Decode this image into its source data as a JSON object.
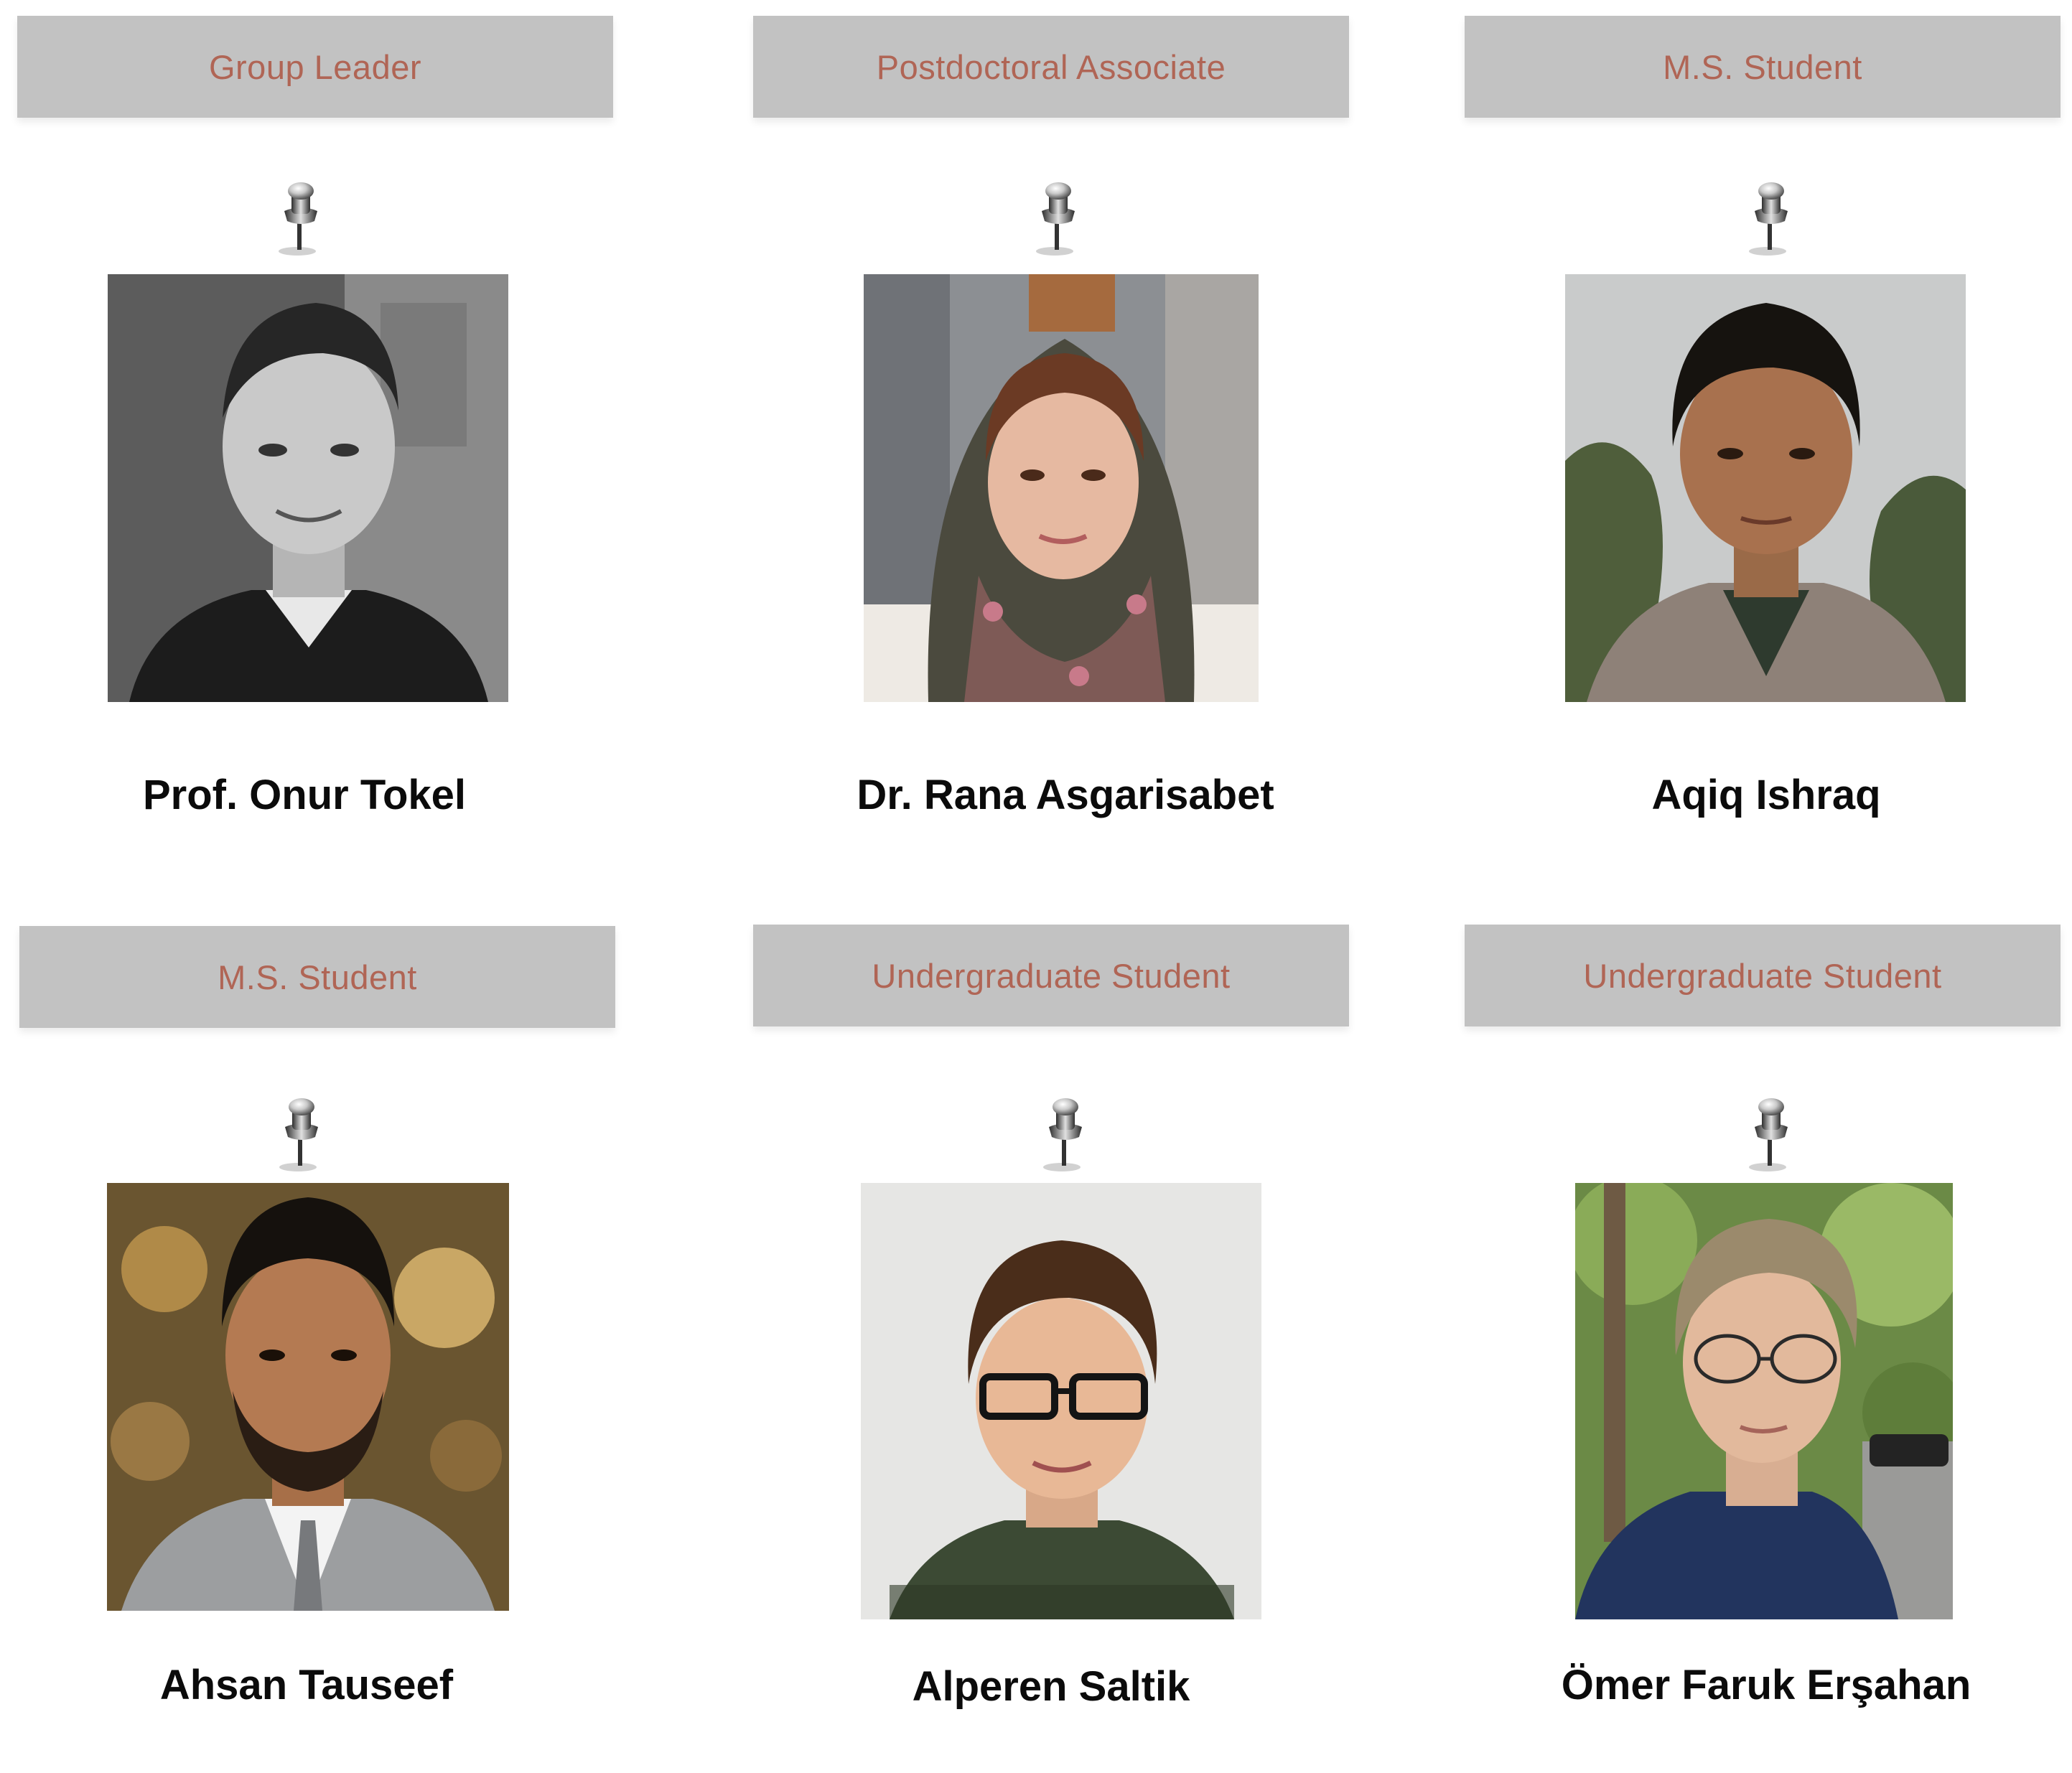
{
  "members": [
    {
      "role": "Group Leader",
      "name": "Prof. Onur Tokel",
      "photo_style": "grayscale"
    },
    {
      "role": "Postdoctoral Associate",
      "name": "Dr. Rana Asgarisabet",
      "photo_style": "color"
    },
    {
      "role": "M.S. Student",
      "name": "Aqiq Ishraq",
      "photo_style": "color"
    },
    {
      "role": "M.S. Student",
      "name": "Ahsan Tauseef",
      "photo_style": "color"
    },
    {
      "role": "Undergraduate Student",
      "name": "Alperen Saltik",
      "photo_style": "color"
    },
    {
      "role": "Undergraduate Student",
      "name": "Ömer Faruk Erşahan",
      "photo_style": "color"
    }
  ],
  "icons": {
    "pin": "pushpin-icon"
  },
  "colors": {
    "banner_background": "#c2c2c2",
    "role_text": "#b06555",
    "name_text": "#0b0b0b"
  }
}
